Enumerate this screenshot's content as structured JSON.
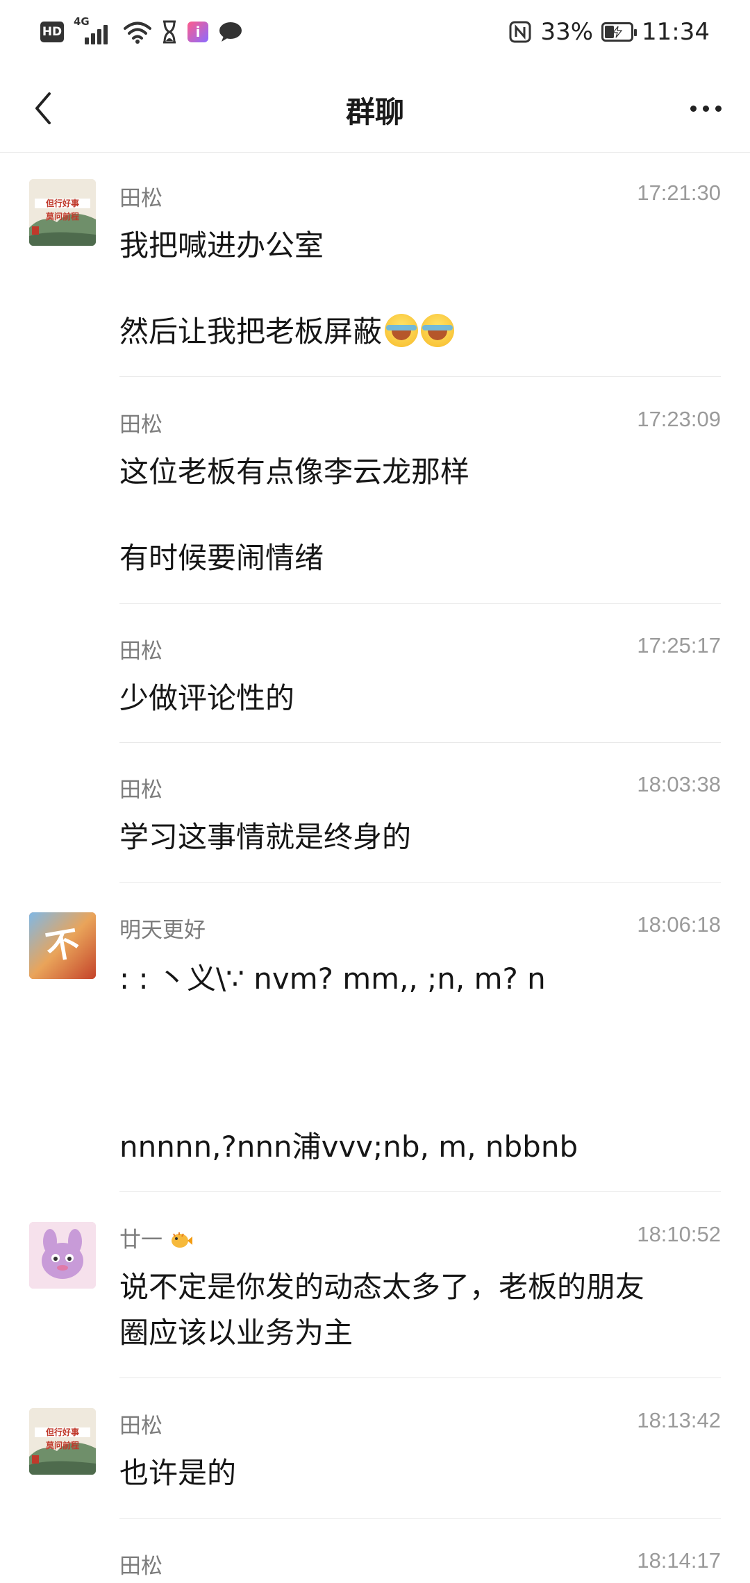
{
  "status_bar": {
    "hd": "HD",
    "net": "4G",
    "app_icon_letter": "i",
    "battery": "33%",
    "time": "11:34"
  },
  "header": {
    "title": "群聊"
  },
  "messages": [
    {
      "sender": "田松",
      "time": "17:21:30",
      "lines": [
        "我把喊进办公室",
        "然后让我把老板屏蔽"
      ],
      "emoji": "loudly-crying-face x2"
    },
    {
      "sender": "田松",
      "time": "17:23:09",
      "lines": [
        "这位老板有点像李云龙那样",
        "有时候要闹情绪"
      ]
    },
    {
      "sender": "田松",
      "time": "17:25:17",
      "lines": [
        "少做评论性的"
      ]
    },
    {
      "sender": "田松",
      "time": "18:03:38",
      "lines": [
        "学习这事情就是终身的"
      ]
    },
    {
      "sender": "明天更好",
      "time": "18:06:18",
      "lines": [
        ":   :   丶义\\∵ nvm? mm,, ;n, m? n",
        "nnnnn,?nnn浦vvv;nb, m, nbbnb"
      ]
    },
    {
      "sender": "廿一",
      "time": "18:10:52",
      "lines": [
        "说不定是你发的动态太多了，老板的朋友",
        "圈应该以业务为主"
      ]
    },
    {
      "sender": "田松",
      "time": "18:13:42",
      "lines": [
        "也许是的"
      ]
    },
    {
      "sender": "田松",
      "time": "18:14:17",
      "lines": []
    }
  ],
  "avatar_texts": {
    "tiansong_line1": "但行好事",
    "tiansong_line2": "莫问前程",
    "mingtian": "不"
  },
  "icons": {
    "back": "chevron-left-icon",
    "more": "more-dots-icon",
    "sender_badge": "pufferfish-emoji"
  }
}
